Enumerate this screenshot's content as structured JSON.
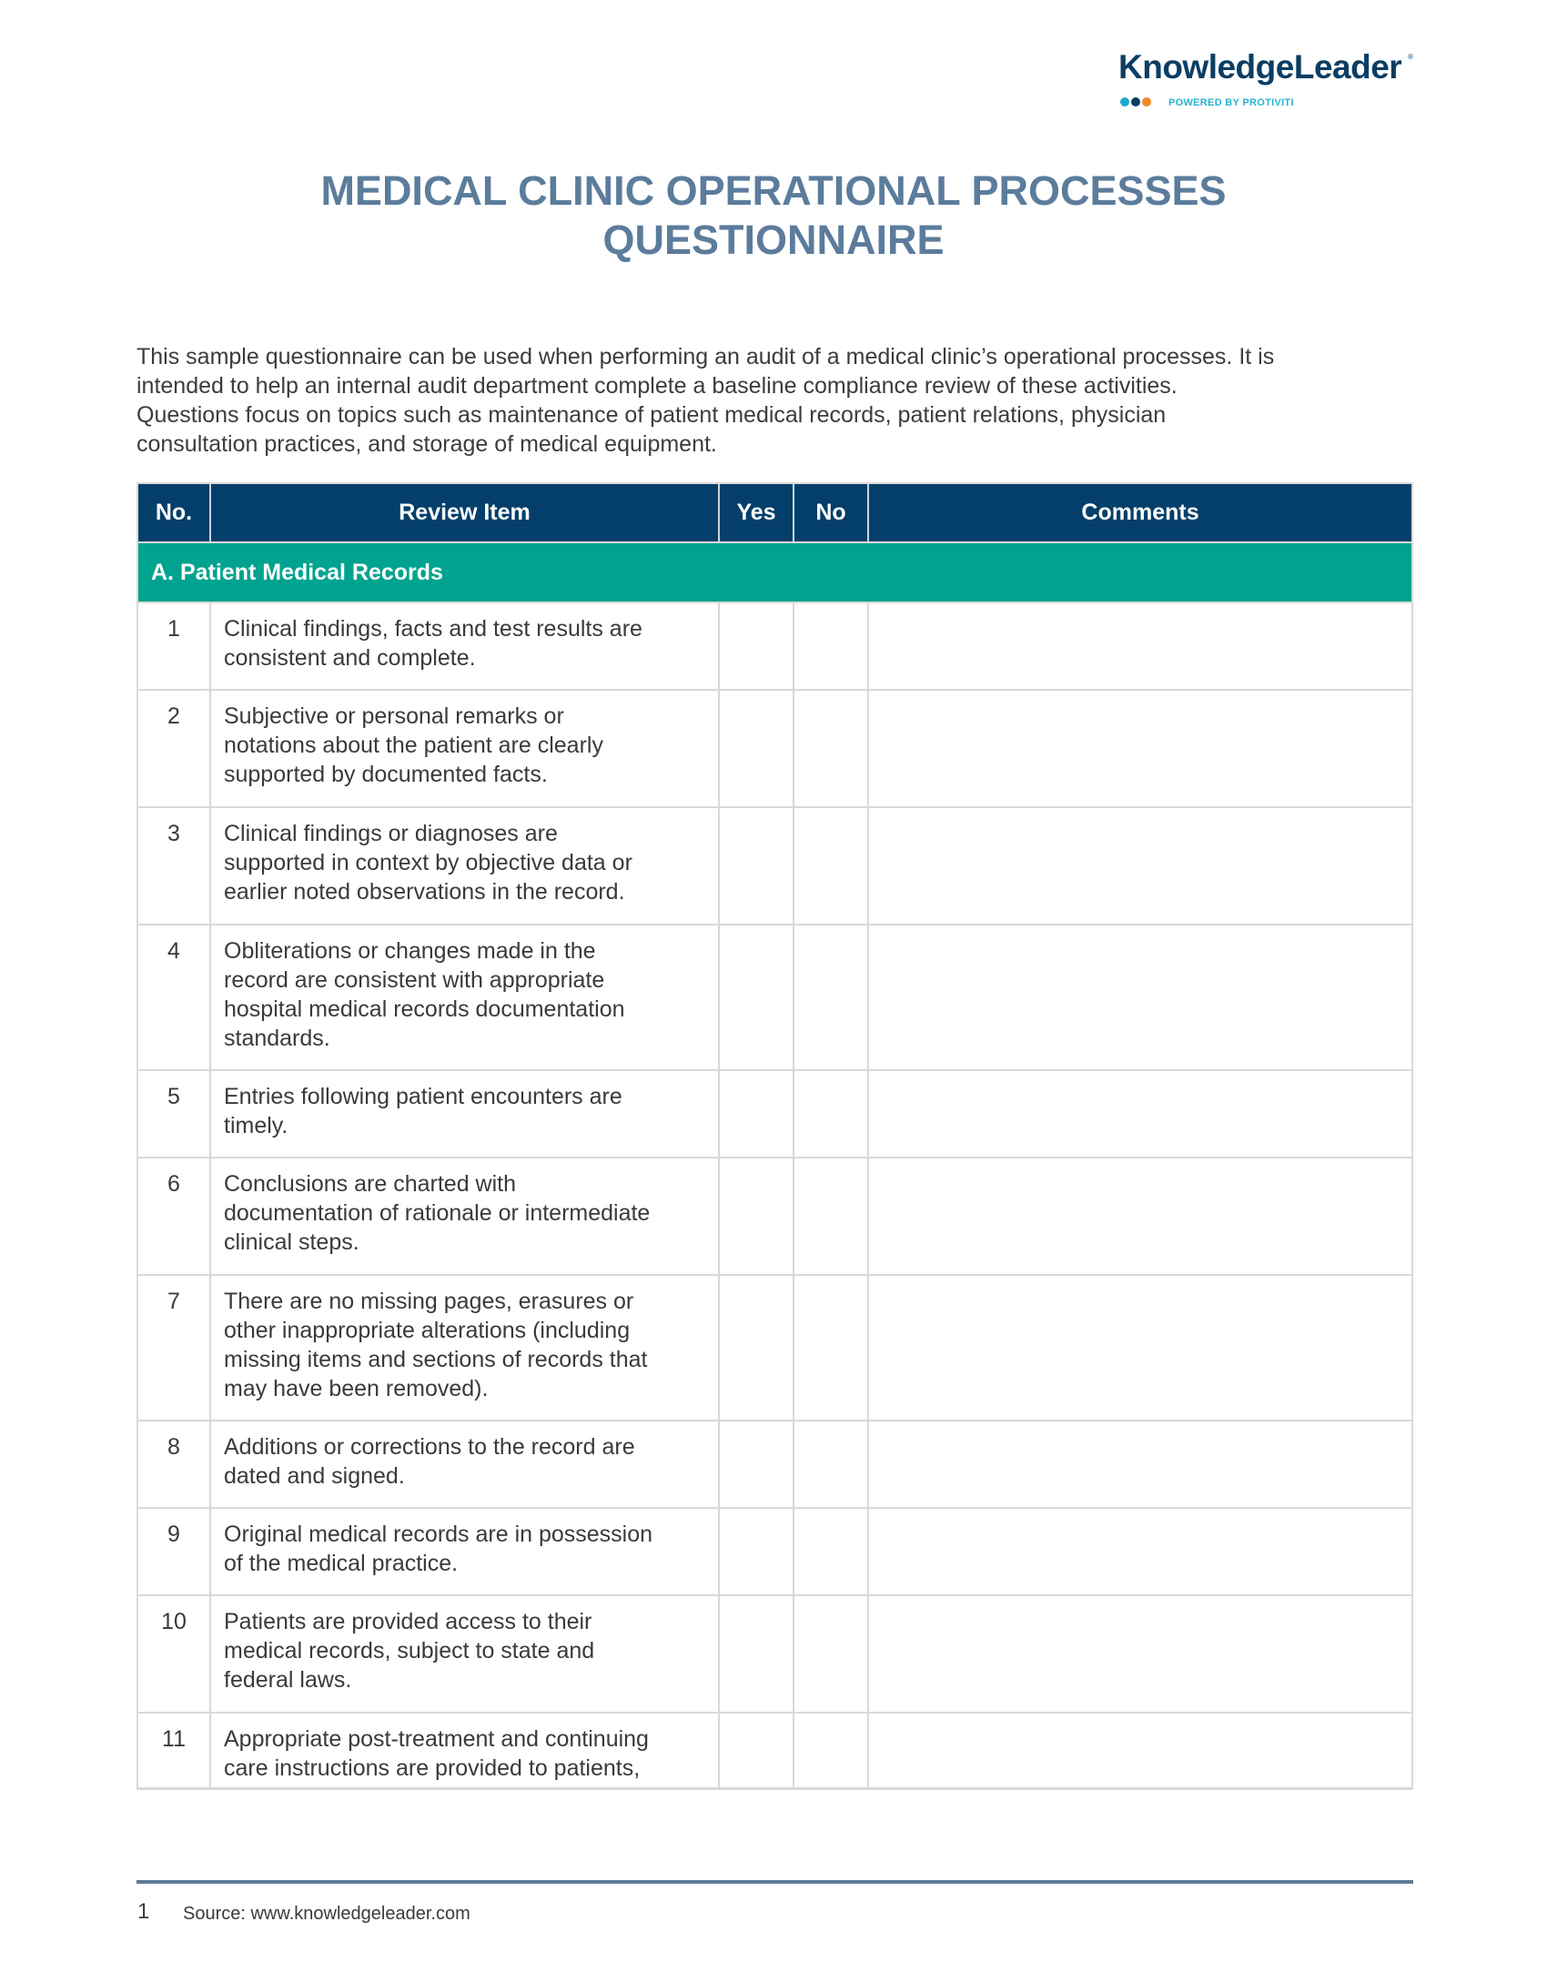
{
  "logo": {
    "brand": "KnowledgeLeader",
    "registered_mark": "®",
    "tagline": "POWERED BY PROTIVITI",
    "dot_colors": [
      "#1aa9cf",
      "#0b3d63",
      "#f28a24"
    ]
  },
  "title": {
    "line1": "MEDICAL CLINIC OPERATIONAL PROCESSES",
    "line2": "QUESTIONNAIRE"
  },
  "intro": {
    "lines": [
      "This sample questionnaire can be used when performing an audit of a medical clinic’s operational processes. It is",
      "intended to help an internal audit department complete a baseline compliance review of these activities.",
      "Questions focus on topics such as maintenance of patient medical records, patient relations, physician",
      "consultation practices, and storage of medical equipment."
    ]
  },
  "table": {
    "headers": {
      "no": "No.",
      "item": "Review Item",
      "yes": "Yes",
      "no_answer": "No",
      "comments": "Comments"
    },
    "sections": [
      {
        "title": "A. Patient Medical Records",
        "rows": [
          {
            "no": "1",
            "lines": [
              "Clinical findings, facts and test results are",
              "consistent and complete."
            ],
            "yes": "",
            "no_answer": "",
            "comments": ""
          },
          {
            "no": "2",
            "lines": [
              "Subjective or personal remarks or",
              "notations about the patient are clearly",
              "supported by documented facts."
            ],
            "yes": "",
            "no_answer": "",
            "comments": ""
          },
          {
            "no": "3",
            "lines": [
              "Clinical findings or diagnoses are",
              "supported in context by objective data or",
              "earlier noted observations in the record."
            ],
            "yes": "",
            "no_answer": "",
            "comments": ""
          },
          {
            "no": "4",
            "lines": [
              "Obliterations or changes made in the",
              "record are consistent with appropriate",
              "hospital medical records documentation",
              "standards."
            ],
            "yes": "",
            "no_answer": "",
            "comments": ""
          },
          {
            "no": "5",
            "lines": [
              "Entries following patient encounters are",
              "timely."
            ],
            "yes": "",
            "no_answer": "",
            "comments": ""
          },
          {
            "no": "6",
            "lines": [
              "Conclusions are charted with",
              "documentation of rationale or intermediate",
              "clinical steps."
            ],
            "yes": "",
            "no_answer": "",
            "comments": ""
          },
          {
            "no": "7",
            "lines": [
              "There are no missing pages, erasures or",
              "other inappropriate alterations (including",
              "missing items and sections of records that",
              "may have been removed)."
            ],
            "yes": "",
            "no_answer": "",
            "comments": ""
          },
          {
            "no": "8",
            "lines": [
              "Additions or corrections to the record are",
              "dated and signed."
            ],
            "yes": "",
            "no_answer": "",
            "comments": ""
          },
          {
            "no": "9",
            "lines": [
              "Original medical records are in possession",
              "of the medical practice."
            ],
            "yes": "",
            "no_answer": "",
            "comments": ""
          },
          {
            "no": "10",
            "lines": [
              "Patients are provided access to their",
              "medical records, subject to state and",
              "federal laws."
            ],
            "yes": "",
            "no_answer": "",
            "comments": ""
          },
          {
            "no": "11",
            "lines": [
              "Appropriate post-treatment and continuing",
              "care instructions are provided to patients,"
            ],
            "yes": "",
            "no_answer": "",
            "comments": ""
          }
        ]
      }
    ]
  },
  "footer": {
    "page_number": "1",
    "source": "Source: www.knowledgeleader.com"
  }
}
